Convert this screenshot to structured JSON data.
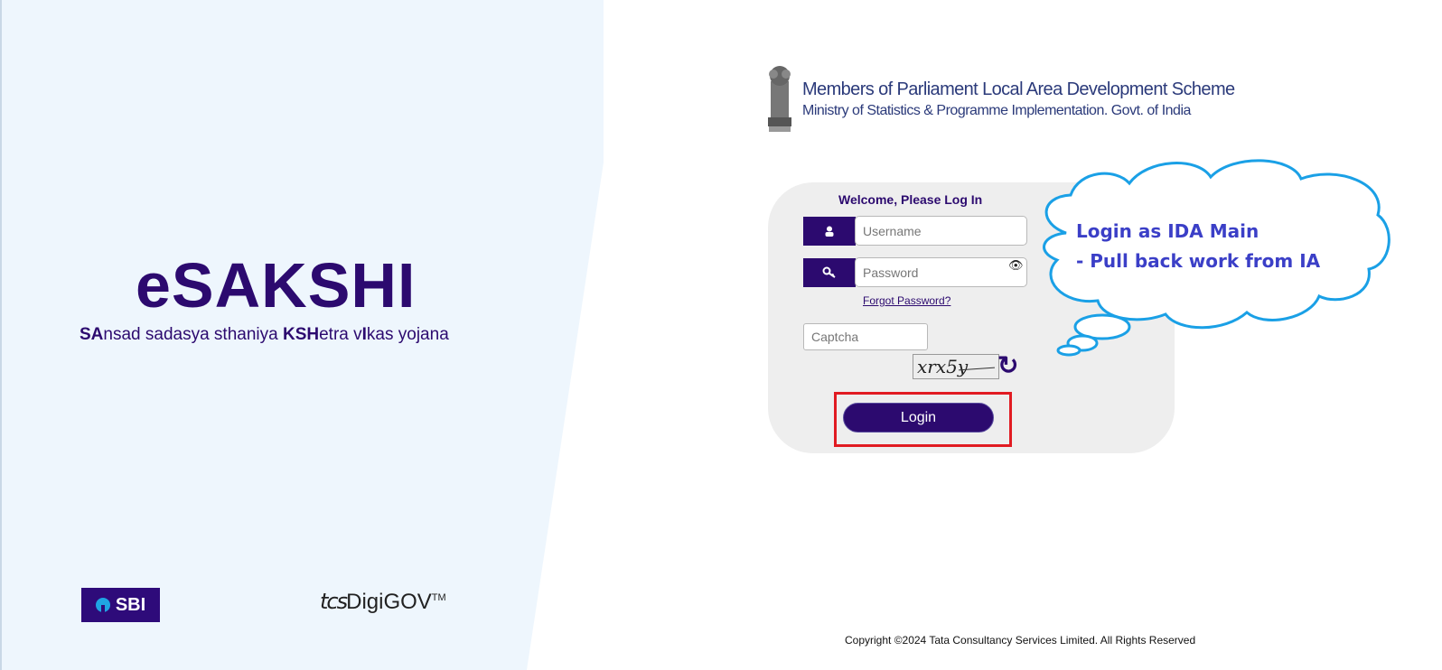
{
  "brand": {
    "title": "eSAKSHI",
    "tagline": {
      "p1_bold": "SA",
      "p2": "nsad sadasya sthaniya ",
      "p3_bold": "KSH",
      "p4": "etra v",
      "p5_bold": "I",
      "p6": "kas yojana"
    }
  },
  "partners": {
    "sbi": "SBI",
    "tcs": {
      "prefix": "tcs",
      "name": "DigiGOV",
      "tm": "TM"
    }
  },
  "ministry": {
    "line1": "Members of Parliament Local Area Development Scheme",
    "line2": "Ministry of Statistics & Programme Implementation. Govt. of India"
  },
  "login": {
    "welcome": "Welcome, Please Log In",
    "username_placeholder": "Username",
    "password_placeholder": "Password",
    "forgot": "Forgot Password?",
    "captcha_placeholder": "Captcha",
    "captcha_text": "xrx5y",
    "button": "Login"
  },
  "annotation": {
    "line1": "Login as IDA Main",
    "line2": "- Pull back work from IA"
  },
  "footer": {
    "copyright": "Copyright ©2024 Tata Consultancy Services Limited. All Rights Reserved"
  },
  "colors": {
    "brand_purple": "#2c0a6f",
    "left_bg": "#eef6fd",
    "card_bg": "#eeeeee",
    "highlight_red": "#e11b22",
    "cloud_blue": "#1aa0e6"
  }
}
